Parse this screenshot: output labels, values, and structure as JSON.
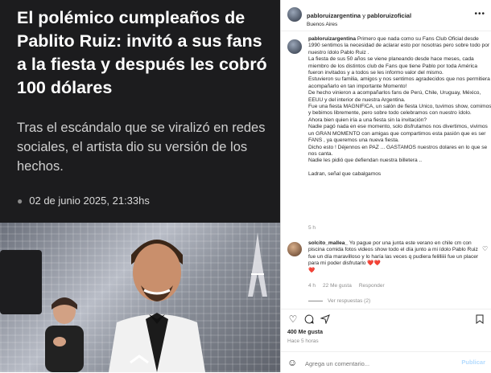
{
  "article": {
    "headline": "El polémico cumpleaños de Pablito Ruiz: invitó a sus fans a la fiesta y después les cobró 100 dólares",
    "subhead": "Tras el escándalo que se viralizó en redes sociales, el artista dio su versión de los hechos.",
    "date": "02 de junio 2025, 21:33hs"
  },
  "post": {
    "author": "pabloruizargentina",
    "connector": "y",
    "coauthor": "pabloruizoficial",
    "location": "Buenos Aires",
    "caption_user": "pabloruizargentina",
    "caption_lines": [
      "Primero que nada como su Fans Club Oficial desde 1990 sentimos la necesidad de aclarar esto por nosotras pero sobre todo por nuestro ídolo Pablo Ruiz .",
      "La fiesta de sus 50 años se viene planeando desde hace meses, cada miembro de los distintos club de Fans que tiene Pablo por toda América fueron invitados y a todos se les informo valor del mismo.",
      "Estuvieron su familia, amigos y nos sentimos agradecidos que nos permitiera acompañarlo en tan importante Momento!",
      "De hecho vinieron a acompañarlos fans de Perú, Chile, Uruguay, México, EEUU y del interior de nuestra Argentina.",
      "Fue una fiesta MAGNIFICA, un salón de fiesta Unico, tuvimos show, comimos y bebimos libremente, pero sobre todo celebramos con nuestro ídolo.",
      "Ahora bien quien iría a una fiesta sin la invitación?",
      "Nadie pagó nada en ese momento, solo disfrutamos nos divertimos, vivimos un GRAN MOMENTO con amigas que compartimos esta pasión que es ser FANS , ya queremos una nueva fiesta.",
      "Dicho esto ! Déjennos en PAZ ... GASTAMOS nuestros dolares en lo que se nos canta.",
      "Nadie les pidió que defiendan nuestra billetera ..",
      "",
      "Ladran, señal que cabalgamos"
    ],
    "caption_time": "5 h",
    "comment": {
      "user": "solcito_mallea_",
      "text": "Yo pague por una junta este verano en chile cm con piscina comida fotos videos show todo el día junto a mi ídolo Pablo Ruiz fue un día maravilloso y lo haría las veces q pudiera felilliiii fue un placer para mi poder disfrutarlo",
      "hearts": "❤️❤️",
      "heart_extra": "❤️",
      "time": "4 h",
      "likes": "22 Me gusta",
      "reply": "Responder",
      "view_replies": "Ver respuestas (2)"
    },
    "likes": "400 Me gusta",
    "ago": "Hace 5 horas",
    "add_comment_placeholder": "Agrega un comentario...",
    "publish": "Publicar"
  }
}
